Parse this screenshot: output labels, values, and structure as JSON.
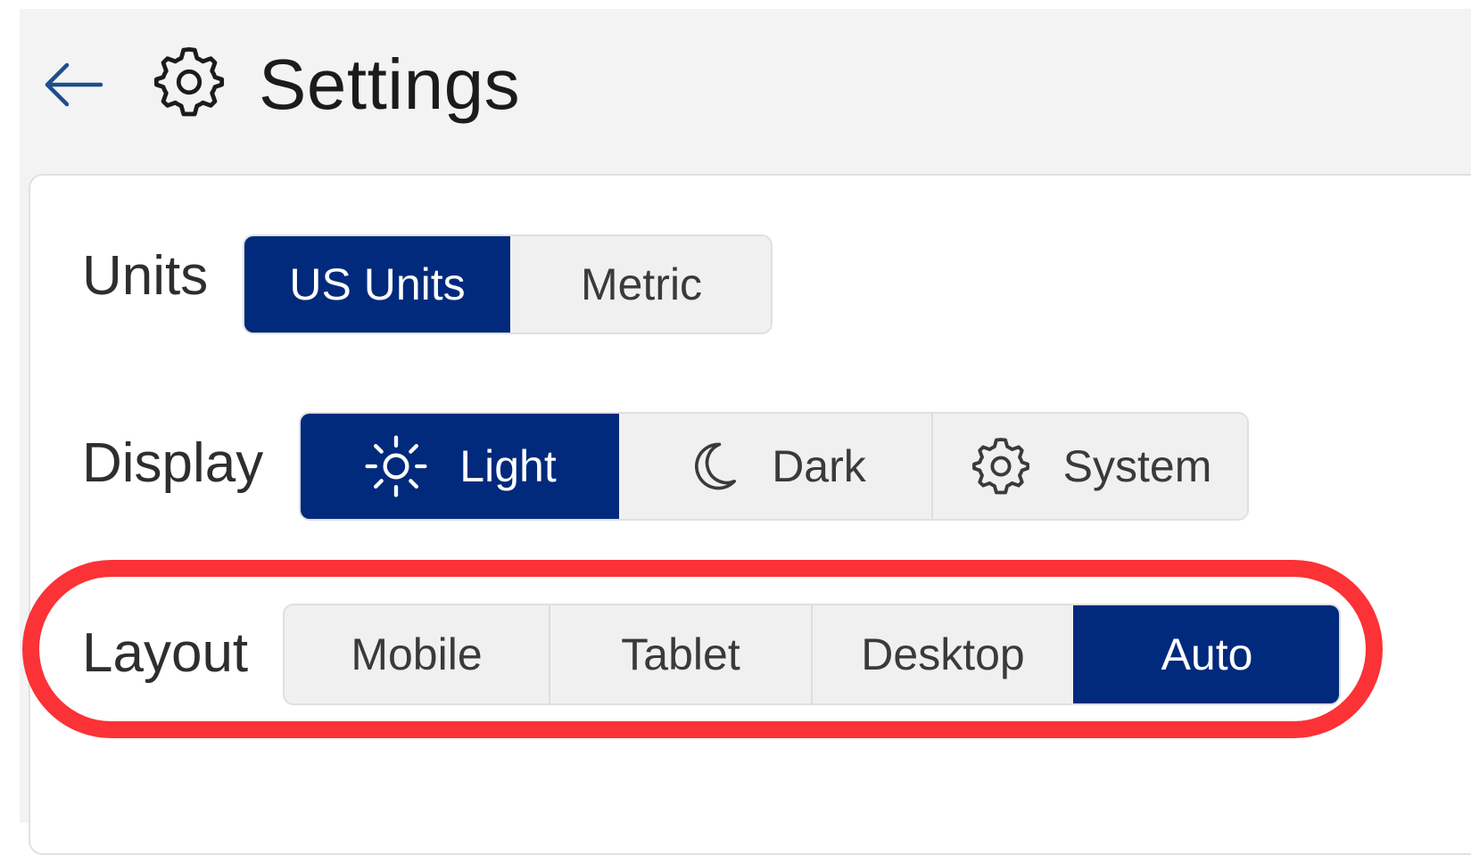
{
  "header": {
    "title": "Settings",
    "back_icon": "arrow-left-icon",
    "title_icon": "gear-icon"
  },
  "settings": {
    "units": {
      "label": "Units",
      "options": [
        "US Units",
        "Metric"
      ],
      "selected": "US Units"
    },
    "display": {
      "label": "Display",
      "options": [
        {
          "label": "Light",
          "icon": "sun-icon"
        },
        {
          "label": "Dark",
          "icon": "moon-icon"
        },
        {
          "label": "System",
          "icon": "gear-icon"
        }
      ],
      "selected": "Light"
    },
    "layout": {
      "label": "Layout",
      "options": [
        "Mobile",
        "Tablet",
        "Desktop",
        "Auto"
      ],
      "selected": "Auto"
    }
  },
  "colors": {
    "accent": "#012a7c",
    "highlight": "#fb3236",
    "background": "#f3f3f3"
  }
}
